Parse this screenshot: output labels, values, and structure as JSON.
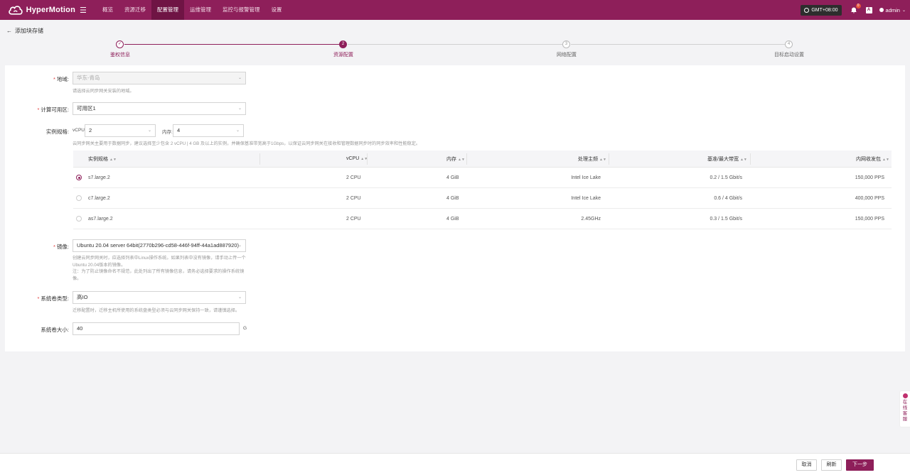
{
  "app": {
    "name": "HyperMotion"
  },
  "nav": [
    {
      "label": "概览",
      "active": false
    },
    {
      "label": "资源迁移",
      "active": false
    },
    {
      "label": "配置管理",
      "active": true
    },
    {
      "label": "运维管理",
      "active": false
    },
    {
      "label": "监控与报警管理",
      "active": false
    },
    {
      "label": "设置",
      "active": false
    }
  ],
  "header": {
    "timezone": "GMT+08:00",
    "notification_count": "0",
    "user": "admin"
  },
  "page": {
    "title": "添加块存储"
  },
  "steps": [
    {
      "num": "1",
      "label": "鉴权信息",
      "state": "done"
    },
    {
      "num": "2",
      "label": "资源配置",
      "state": "current"
    },
    {
      "num": "3",
      "label": "网络配置",
      "state": "todo"
    },
    {
      "num": "4",
      "label": "目标启动设置",
      "state": "todo"
    }
  ],
  "form": {
    "region": {
      "label": "地域:",
      "value": "华东-青岛",
      "hint": "请选择云同步网关安装的地域。"
    },
    "zone": {
      "label": "计算可用区:",
      "value": "可用区1"
    },
    "spec": {
      "label": "实例规格:",
      "vcpu_label": "vCPU:",
      "vcpu_value": "2",
      "mem_label": "内存:",
      "mem_value": "4",
      "hint": "云同步网关主要用于数据同步，建议选择至少包含 2 vCPU | 4 GB 及以上的实例，并确保基准带宽高于1Gbps，以保证云同步网关在接收和管理数据同步时的同步效率和性能稳定。"
    },
    "table": {
      "headers": [
        "实例规格",
        "vCPU",
        "内存",
        "处理主频",
        "基准/最大带宽",
        "内网收发包"
      ],
      "rows": [
        {
          "selected": true,
          "name": "s7.large.2",
          "vcpu": "2 CPU",
          "mem": "4 GiB",
          "freq": "Intel Ice Lake",
          "bw": "0.2 / 1.5 Gbit/s",
          "pps": "150,000 PPS"
        },
        {
          "selected": false,
          "name": "c7.large.2",
          "vcpu": "2 CPU",
          "mem": "4 GiB",
          "freq": "Intel Ice Lake",
          "bw": "0.6 / 4 Gbit/s",
          "pps": "400,000 PPS"
        },
        {
          "selected": false,
          "name": "as7.large.2",
          "vcpu": "2 CPU",
          "mem": "4 GiB",
          "freq": "2.45GHz",
          "bw": "0.3 / 1.5 Gbit/s",
          "pps": "150,000 PPS"
        }
      ]
    },
    "image": {
      "label": "镜像:",
      "value": "Ubuntu 20.04 server 64bit(2770b296-cd58-446f-94ff-44a1ad887920)",
      "hint1": "创建云同步网关时，应选择列表中Linux操作系统。如果列表中没有镜像，请手动上传一个",
      "hint2": "Ubuntu 20.04版本的镜像。",
      "hint3": "注：为了防止镜像命名不规范，此处列出了所有镜像信息，请务必选择要求的操作系统镜",
      "hint4": "像。"
    },
    "disk_type": {
      "label": "系统卷类型:",
      "value": "高IO",
      "hint": "迁移配置时，迁移主机所使用的系统盘类型必须与云同步网关保持一致，请谨慎选择。"
    },
    "disk_size": {
      "label": "系统卷大小:",
      "value": "40",
      "unit": "G"
    }
  },
  "footer": {
    "cancel": "取消",
    "refresh": "刷新",
    "next": "下一步"
  },
  "side_service": {
    "label": "在线客服"
  },
  "colors": {
    "brand": "#8e1f5a",
    "required": "#e13b3b"
  }
}
